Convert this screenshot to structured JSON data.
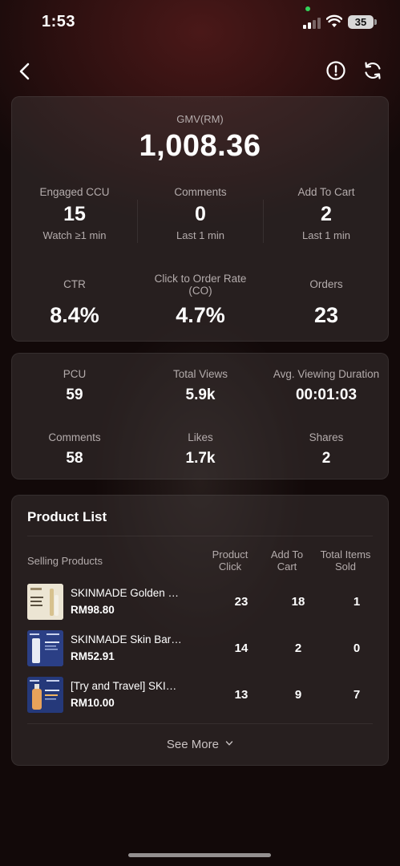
{
  "status_bar": {
    "time": "1:53",
    "battery": "35"
  },
  "gmv": {
    "label": "GMV(RM)",
    "value": "1,008.36"
  },
  "metrics_row1": [
    {
      "label": "Engaged CCU",
      "value": "15",
      "sub": "Watch ≥1 min"
    },
    {
      "label": "Comments",
      "value": "0",
      "sub": "Last 1 min"
    },
    {
      "label": "Add To Cart",
      "value": "2",
      "sub": "Last 1 min"
    }
  ],
  "metrics_row2": [
    {
      "label": "CTR",
      "value": "8.4%"
    },
    {
      "label": "Click to Order Rate",
      "label2": "(CO)",
      "value": "4.7%"
    },
    {
      "label": "Orders",
      "value": "23"
    }
  ],
  "stats": [
    {
      "label": "PCU",
      "value": "59"
    },
    {
      "label": "Total Views",
      "value": "5.9k"
    },
    {
      "label": "Avg. Viewing Duration",
      "value": "00:01:03"
    },
    {
      "label": "Comments",
      "value": "58"
    },
    {
      "label": "Likes",
      "value": "1.7k"
    },
    {
      "label": "Shares",
      "value": "2"
    }
  ],
  "product_list": {
    "title": "Product List",
    "headers": {
      "selling_products": "Selling Products",
      "product_click_1": "Product",
      "product_click_2": "Click",
      "add_to_cart_1": "Add To",
      "add_to_cart_2": "Cart",
      "total_items_1": "Total Items",
      "total_items_2": "Sold"
    },
    "products": [
      {
        "name": "SKINMADE Golden Collagen Sculpting Mist",
        "price": "RM98.80",
        "click": "23",
        "cart": "18",
        "sold": "1",
        "thumb_color": "#e9e2d0"
      },
      {
        "name": "SKINMADE Skin Barrier Serum",
        "price": "RM52.91",
        "click": "14",
        "cart": "2",
        "sold": "0",
        "thumb_color": "#2a3f86"
      },
      {
        "name": "[Try and Travel] SKINMADE Essence",
        "price": "RM10.00",
        "click": "13",
        "cart": "9",
        "sold": "7",
        "thumb_color": "#243b7a"
      }
    ],
    "see_more": "See More"
  },
  "colors": {
    "accent_text": "#ffffff",
    "muted_text": "#b4acac",
    "card_bg": "rgba(70,62,62,0.42)"
  }
}
